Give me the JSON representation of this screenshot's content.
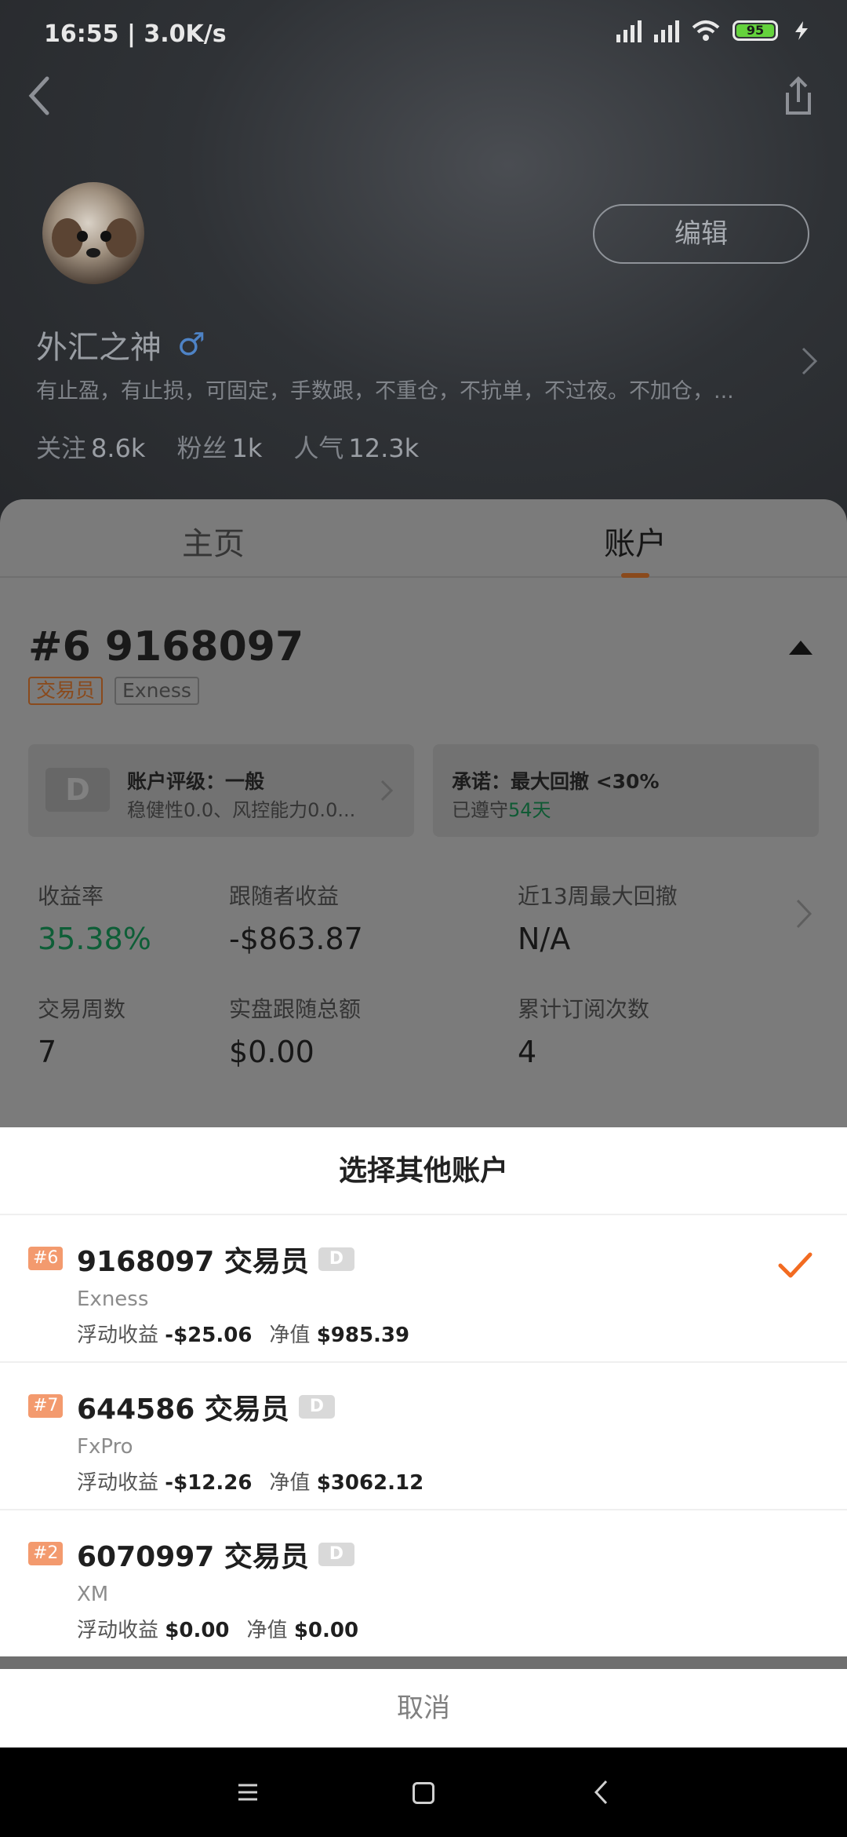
{
  "status_bar": {
    "time": "16:55 | 3.0K/s",
    "battery": "95",
    "icons": [
      "hd-signal-icon",
      "signal-icon",
      "wifi-icon",
      "battery-icon",
      "charging-icon"
    ]
  },
  "profile": {
    "edit_label": "编辑",
    "nickname": "外汇之神",
    "gender_symbol": "♂",
    "bio": "有止盈，有止损，可固定，手数跟，不重仓，不抗单，不过夜。不加仓，...",
    "stats": [
      {
        "label": "关注",
        "value": "8.6k"
      },
      {
        "label": "粉丝",
        "value": "1k"
      },
      {
        "label": "人气",
        "value": "12.3k"
      }
    ]
  },
  "tabs": {
    "home": "主页",
    "account": "账户",
    "active": "account"
  },
  "account": {
    "title": "#6 9168097",
    "tag_role": "交易员",
    "tag_broker": "Exness",
    "rating_badge": "D",
    "rating_title": "账户评级：一般",
    "rating_sub": "稳健性0.0、风控能力0.0...",
    "promise_title": "承诺：最大回撤 <30%",
    "promise_prefix": "已遵守",
    "promise_days": "54天",
    "metrics": [
      {
        "label": "收益率",
        "value": "35.38%"
      },
      {
        "label": "跟随者收益",
        "value": "-$863.87"
      },
      {
        "label": "近13周最大回撤",
        "value": "N/A"
      },
      {
        "label": "交易周数",
        "value": "7"
      },
      {
        "label": "实盘跟随总额",
        "value": "$0.00"
      },
      {
        "label": "累计订阅次数",
        "value": "4"
      }
    ]
  },
  "sheet": {
    "title": "选择其他账户",
    "cancel": "取消",
    "float_label": "浮动收益",
    "equity_label": "净值",
    "accounts": [
      {
        "index": "#6",
        "title": "9168097 交易员",
        "grade": "D",
        "broker": "Exness",
        "float": "-$25.06",
        "equity": "$985.39",
        "selected": true
      },
      {
        "index": "#7",
        "title": "644586 交易员",
        "grade": "D",
        "broker": "FxPro",
        "float": "-$12.26",
        "equity": "$3062.12",
        "selected": false
      },
      {
        "index": "#2",
        "title": "6070997 交易员",
        "grade": "D",
        "broker": "XM",
        "float": "$0.00",
        "equity": "$0.00",
        "selected": false
      }
    ]
  },
  "colors": {
    "accent": "#F26B21",
    "green": "#1BA36A",
    "badge_index": "#F39A6E"
  }
}
